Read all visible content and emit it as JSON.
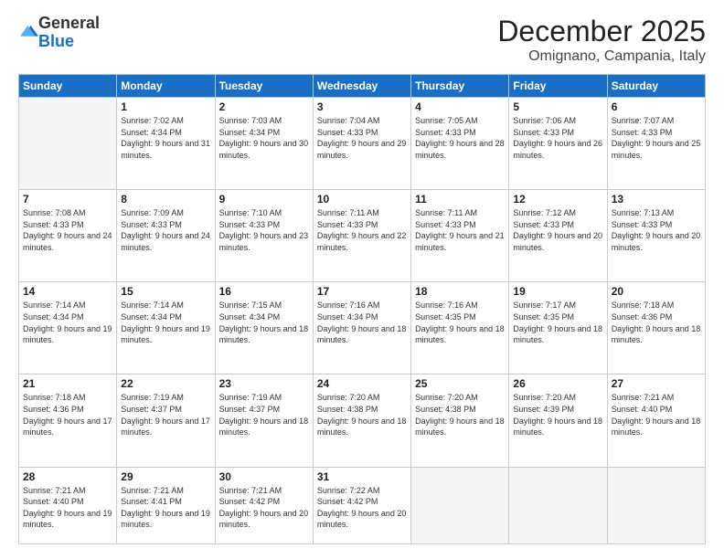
{
  "logo": {
    "general": "General",
    "blue": "Blue"
  },
  "header": {
    "month": "December 2025",
    "location": "Omignano, Campania, Italy"
  },
  "weekdays": [
    "Sunday",
    "Monday",
    "Tuesday",
    "Wednesday",
    "Thursday",
    "Friday",
    "Saturday"
  ],
  "weeks": [
    [
      {
        "day": "",
        "empty": true
      },
      {
        "day": "1",
        "sunrise": "7:02 AM",
        "sunset": "4:34 PM",
        "daylight": "9 hours and 31 minutes."
      },
      {
        "day": "2",
        "sunrise": "7:03 AM",
        "sunset": "4:34 PM",
        "daylight": "9 hours and 30 minutes."
      },
      {
        "day": "3",
        "sunrise": "7:04 AM",
        "sunset": "4:33 PM",
        "daylight": "9 hours and 29 minutes."
      },
      {
        "day": "4",
        "sunrise": "7:05 AM",
        "sunset": "4:33 PM",
        "daylight": "9 hours and 28 minutes."
      },
      {
        "day": "5",
        "sunrise": "7:06 AM",
        "sunset": "4:33 PM",
        "daylight": "9 hours and 26 minutes."
      },
      {
        "day": "6",
        "sunrise": "7:07 AM",
        "sunset": "4:33 PM",
        "daylight": "9 hours and 25 minutes."
      }
    ],
    [
      {
        "day": "7",
        "sunrise": "7:08 AM",
        "sunset": "4:33 PM",
        "daylight": "9 hours and 24 minutes."
      },
      {
        "day": "8",
        "sunrise": "7:09 AM",
        "sunset": "4:33 PM",
        "daylight": "9 hours and 24 minutes."
      },
      {
        "day": "9",
        "sunrise": "7:10 AM",
        "sunset": "4:33 PM",
        "daylight": "9 hours and 23 minutes."
      },
      {
        "day": "10",
        "sunrise": "7:11 AM",
        "sunset": "4:33 PM",
        "daylight": "9 hours and 22 minutes."
      },
      {
        "day": "11",
        "sunrise": "7:11 AM",
        "sunset": "4:33 PM",
        "daylight": "9 hours and 21 minutes."
      },
      {
        "day": "12",
        "sunrise": "7:12 AM",
        "sunset": "4:33 PM",
        "daylight": "9 hours and 20 minutes."
      },
      {
        "day": "13",
        "sunrise": "7:13 AM",
        "sunset": "4:33 PM",
        "daylight": "9 hours and 20 minutes."
      }
    ],
    [
      {
        "day": "14",
        "sunrise": "7:14 AM",
        "sunset": "4:34 PM",
        "daylight": "9 hours and 19 minutes."
      },
      {
        "day": "15",
        "sunrise": "7:14 AM",
        "sunset": "4:34 PM",
        "daylight": "9 hours and 19 minutes."
      },
      {
        "day": "16",
        "sunrise": "7:15 AM",
        "sunset": "4:34 PM",
        "daylight": "9 hours and 18 minutes."
      },
      {
        "day": "17",
        "sunrise": "7:16 AM",
        "sunset": "4:34 PM",
        "daylight": "9 hours and 18 minutes."
      },
      {
        "day": "18",
        "sunrise": "7:16 AM",
        "sunset": "4:35 PM",
        "daylight": "9 hours and 18 minutes."
      },
      {
        "day": "19",
        "sunrise": "7:17 AM",
        "sunset": "4:35 PM",
        "daylight": "9 hours and 18 minutes."
      },
      {
        "day": "20",
        "sunrise": "7:18 AM",
        "sunset": "4:36 PM",
        "daylight": "9 hours and 18 minutes."
      }
    ],
    [
      {
        "day": "21",
        "sunrise": "7:18 AM",
        "sunset": "4:36 PM",
        "daylight": "9 hours and 17 minutes."
      },
      {
        "day": "22",
        "sunrise": "7:19 AM",
        "sunset": "4:37 PM",
        "daylight": "9 hours and 17 minutes."
      },
      {
        "day": "23",
        "sunrise": "7:19 AM",
        "sunset": "4:37 PM",
        "daylight": "9 hours and 18 minutes."
      },
      {
        "day": "24",
        "sunrise": "7:20 AM",
        "sunset": "4:38 PM",
        "daylight": "9 hours and 18 minutes."
      },
      {
        "day": "25",
        "sunrise": "7:20 AM",
        "sunset": "4:38 PM",
        "daylight": "9 hours and 18 minutes."
      },
      {
        "day": "26",
        "sunrise": "7:20 AM",
        "sunset": "4:39 PM",
        "daylight": "9 hours and 18 minutes."
      },
      {
        "day": "27",
        "sunrise": "7:21 AM",
        "sunset": "4:40 PM",
        "daylight": "9 hours and 18 minutes."
      }
    ],
    [
      {
        "day": "28",
        "sunrise": "7:21 AM",
        "sunset": "4:40 PM",
        "daylight": "9 hours and 19 minutes."
      },
      {
        "day": "29",
        "sunrise": "7:21 AM",
        "sunset": "4:41 PM",
        "daylight": "9 hours and 19 minutes."
      },
      {
        "day": "30",
        "sunrise": "7:21 AM",
        "sunset": "4:42 PM",
        "daylight": "9 hours and 20 minutes."
      },
      {
        "day": "31",
        "sunrise": "7:22 AM",
        "sunset": "4:42 PM",
        "daylight": "9 hours and 20 minutes."
      },
      {
        "day": "",
        "empty": true
      },
      {
        "day": "",
        "empty": true
      },
      {
        "day": "",
        "empty": true
      }
    ]
  ]
}
